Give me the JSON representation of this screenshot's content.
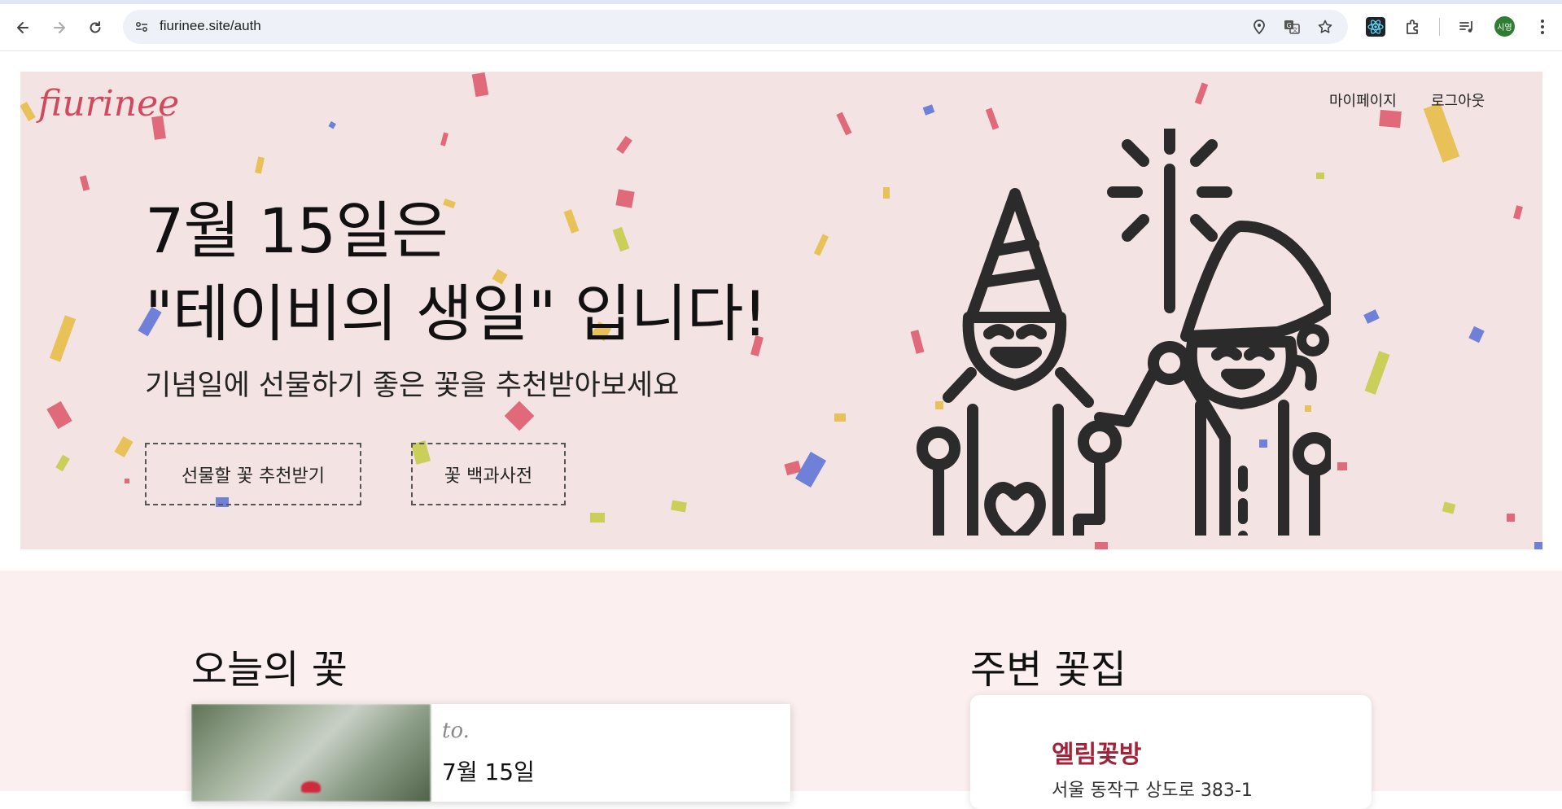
{
  "browser": {
    "url": "fiurinee.site/auth",
    "profile_initials": "시영",
    "icons": [
      "back-icon",
      "forward-icon",
      "reload-icon",
      "site-info-icon",
      "location-icon",
      "translate-icon",
      "bookmark-star-icon",
      "react-devtools-icon",
      "extensions-icon",
      "media-control-icon",
      "menu-icon"
    ]
  },
  "header": {
    "logo": "fiurinee",
    "nav": {
      "mypage": "마이페이지",
      "logout": "로그아웃"
    }
  },
  "hero": {
    "title_line1": "7월 15일은",
    "title_line2": "\"테이비의 생일\" 입니다!",
    "subtitle": "기념일에 선물하기 좋은 꽃을 추천받아보세요",
    "buttons": {
      "recommend": "선물할 꽃 추천받기",
      "encyclopedia": "꽃 백과사전"
    },
    "colors": {
      "background": "#f4e3e3",
      "logo": "#cf4a5e"
    }
  },
  "today_flower": {
    "title": "오늘의 꽃",
    "to_label": "to.",
    "date": "7월 15일"
  },
  "nearby_shops": {
    "title": "주변 꽃집",
    "shops": [
      {
        "name": "엘림꽃방",
        "address": "서울 동작구 상도로 383-1"
      }
    ]
  },
  "colors": {
    "section_background": "#fbefef",
    "shop_name": "#a3233a"
  }
}
